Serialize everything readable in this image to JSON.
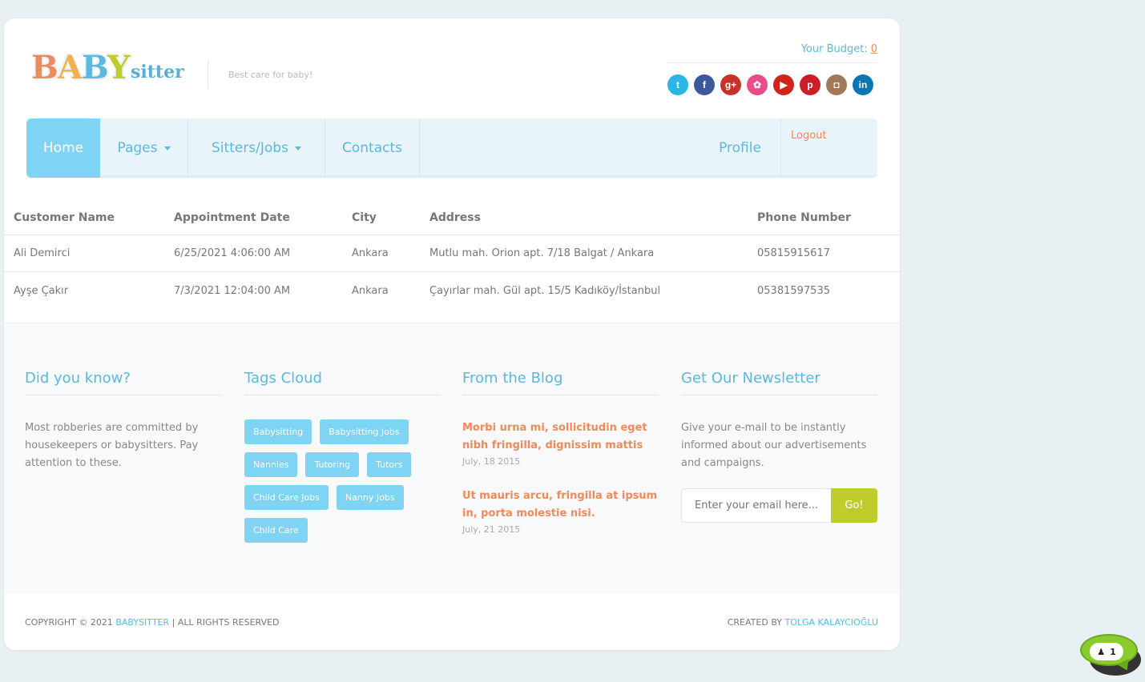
{
  "header": {
    "logo_big": [
      "B",
      "A",
      "B",
      "Y"
    ],
    "logo_small": "sitter",
    "tagline": "Best care for baby!",
    "budget_label": "Your Budget:",
    "budget_value": "0",
    "socials": [
      {
        "icon": "twitter-icon",
        "glyph": "t",
        "color": "#2ab7e6"
      },
      {
        "icon": "facebook-icon",
        "glyph": "f",
        "color": "#3b5a9a"
      },
      {
        "icon": "google-plus-icon",
        "glyph": "g+",
        "color": "#c9322b"
      },
      {
        "icon": "dribbble-icon",
        "glyph": "✿",
        "color": "#e94c89"
      },
      {
        "icon": "youtube-icon",
        "glyph": "▶",
        "color": "#d0231c"
      },
      {
        "icon": "pinterest-icon",
        "glyph": "p",
        "color": "#cb1f27"
      },
      {
        "icon": "instagram-icon",
        "glyph": "◘",
        "color": "#a2785b"
      },
      {
        "icon": "linkedin-icon",
        "glyph": "in",
        "color": "#0a77b5"
      }
    ]
  },
  "nav": {
    "home": "Home",
    "pages": "Pages",
    "sitters_jobs": "Sitters/Jobs",
    "contacts": "Contacts",
    "profile": "Profile",
    "logout": "Logout"
  },
  "table": {
    "headers": [
      "Customer Name",
      "Appointment Date",
      "City",
      "Address",
      "Phone Number"
    ],
    "rows": [
      [
        "Ali Demirci",
        "6/25/2021 4:06:00 AM",
        "Ankara",
        "Mutlu mah. Orion apt. 7/18 Balgat / Ankara",
        "05815915617"
      ],
      [
        "Ayşe Çakır",
        "7/3/2021 12:04:00 AM",
        "Ankara",
        "Çayırlar mah. Gül apt. 15/5 Kadıköy/İstanbul",
        "05381597535"
      ]
    ]
  },
  "footer": {
    "did_you_know": {
      "title": "Did you know?",
      "text": "Most robberies are committed by housekeepers or babysitters. Pay attention to these."
    },
    "tags_cloud": {
      "title": "Tags Cloud",
      "tags": [
        "Babysitting",
        "Babysitting Jobs",
        "Nannies",
        "Tutoring",
        "Tutors",
        "Child Care Jobs",
        "Nanny Jobs",
        "Child Care"
      ]
    },
    "blog": {
      "title": "From the Blog",
      "posts": [
        {
          "title": "Morbi urna mi, sollicitudin eget nibh fringilla, dignissim mattis",
          "date": "July, 18 2015"
        },
        {
          "title": "Ut mauris arcu, fringilla at ipsum in, porta molestie nisi.",
          "date": "July, 21 2015"
        }
      ]
    },
    "newsletter": {
      "title": "Get Our Newsletter",
      "text": "Give your e-mail to be instantly informed about our advertisements and campaigns.",
      "placeholder": "Enter your email here...",
      "button": "Go!"
    }
  },
  "bottom": {
    "copyright_prefix": "COPYRIGHT © 2021",
    "brand": "BABYSITTER",
    "rights": "|  ALL RIGHTS RESERVED",
    "created_by": "CREATED BY",
    "author": "TOLGA KALAYCIOĞLU"
  },
  "chat_widget": {
    "count": "1"
  },
  "colors": {
    "accent_blue": "#5cb8dd",
    "nav_active": "#7fd3f3",
    "accent_orange": "#ef8a5a",
    "accent_green": "#bfcc2b"
  }
}
